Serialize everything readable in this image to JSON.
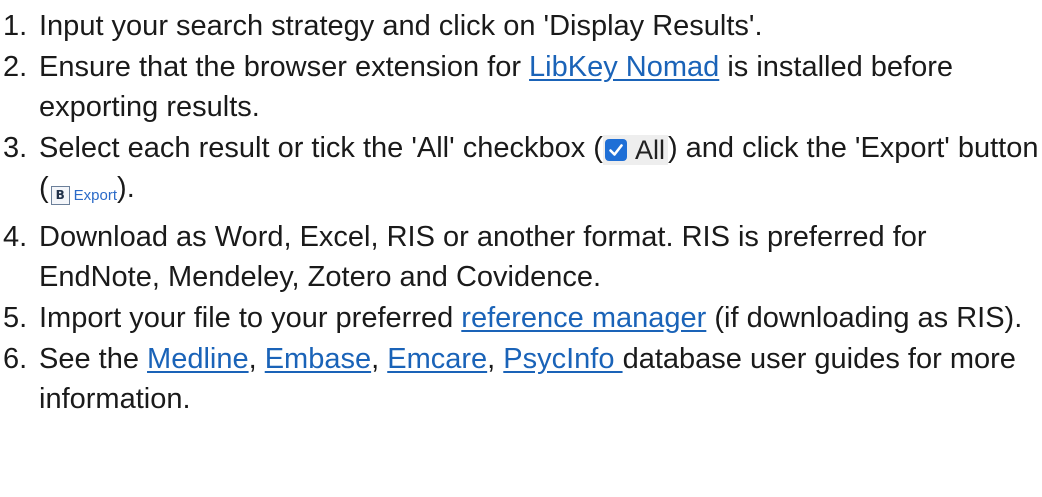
{
  "steps": [
    {
      "num": "1.",
      "text": "Input your search strategy and click on 'Display Results'."
    },
    {
      "num": "2.",
      "before": "Ensure that the browser extension for ",
      "link": "LibKey Nomad",
      "after": " is installed before exporting results."
    },
    {
      "num": "3.",
      "before": "Select each result or tick the 'All' checkbox (",
      "checkbox_label": "All",
      "middle": ") and click the 'Export' button (",
      "export_label": "Export",
      "export_icon_glyph": "B",
      "after": ")."
    },
    {
      "num": "4.",
      "text": "Download as Word, Excel, RIS or another format. RIS is preferred for EndNote, Mendeley, Zotero and Covidence."
    },
    {
      "num": "5.",
      "before": "Import your file to your preferred ",
      "link": "reference manager",
      "after": " (if downloading as RIS)."
    },
    {
      "num": "6.",
      "before": "See the ",
      "links": [
        "Medline",
        "Embase",
        "Emcare",
        "PsycInfo "
      ],
      "sep1": ", ",
      "sep2": ", ",
      "sep3": ", ",
      "after": "database user guides for more information."
    }
  ],
  "colors": {
    "link": "#1a63b8",
    "checkbox": "#1f6fd6",
    "text": "#1a1a1a"
  },
  "icons": {
    "checkbox": "checkmark-icon",
    "export": "export-icon"
  }
}
